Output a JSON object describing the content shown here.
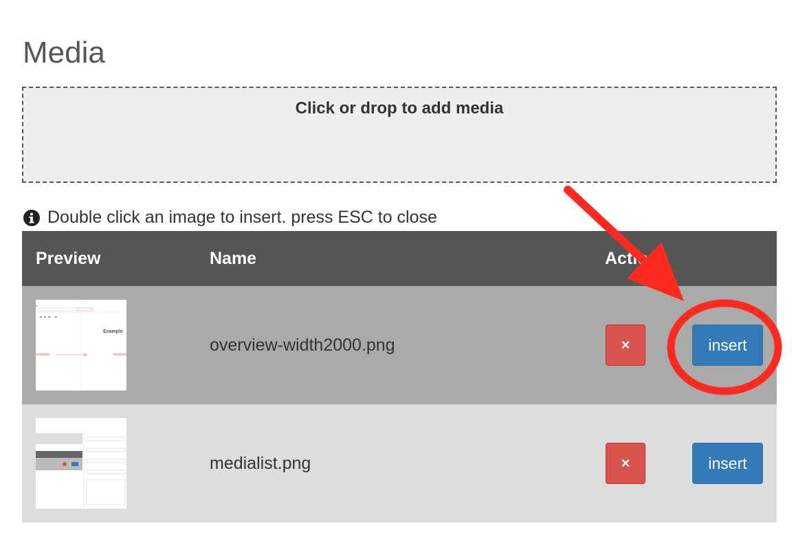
{
  "page": {
    "title": "Media"
  },
  "dropzone": {
    "label": "Click or drop to add media"
  },
  "hint": {
    "icon": "info-circle-icon",
    "text": "Double click an image to insert. press ESC to close"
  },
  "table": {
    "headers": {
      "preview": "Preview",
      "name": "Name",
      "action": "Action"
    },
    "rows": [
      {
        "name": "overview-width2000.png",
        "delete_label": "×",
        "insert_label": "insert",
        "thumb_text": "Example"
      },
      {
        "name": "medialist.png",
        "delete_label": "×",
        "insert_label": "insert"
      }
    ]
  },
  "colors": {
    "header_bg": "#555555",
    "row_highlight": "#aaaaaa",
    "row_normal": "#dddddd",
    "delete_button": "#d9534f",
    "insert_button": "#337ab7",
    "annotation": "#ff2a1f"
  }
}
